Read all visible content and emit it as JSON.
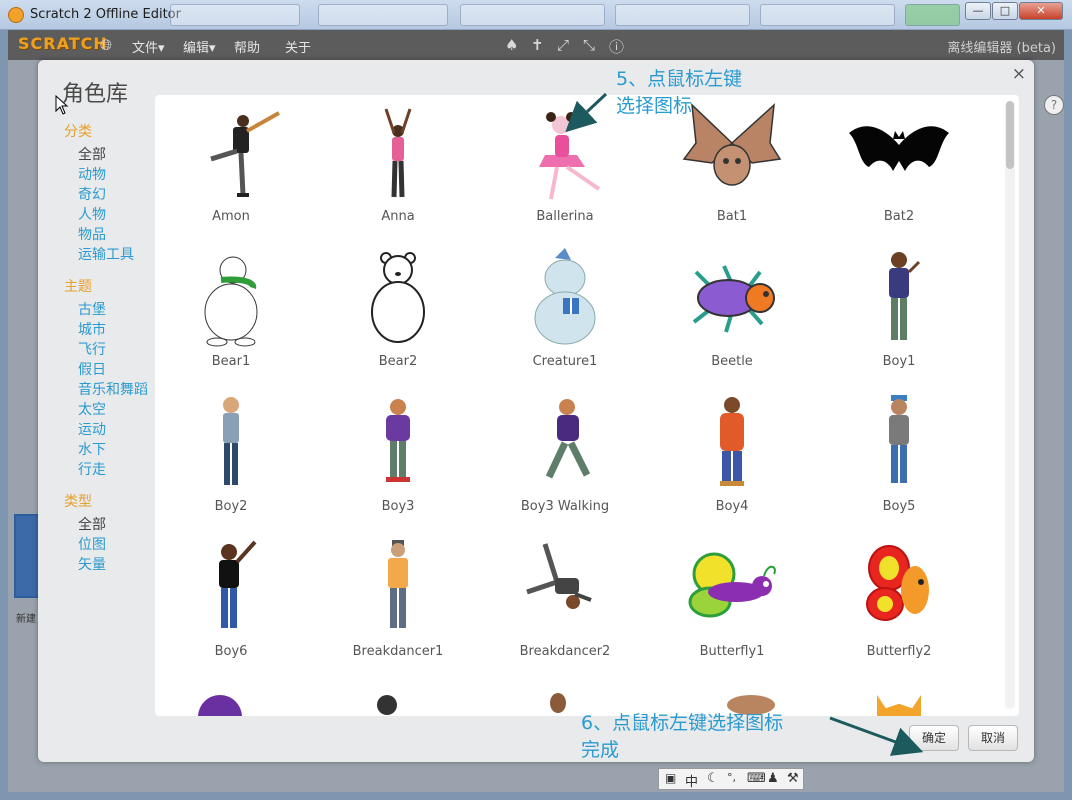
{
  "window": {
    "title": "Scratch 2 Offline Editor",
    "minimize_label": "0",
    "maximize_label": "1",
    "close_label": "r"
  },
  "menubar": {
    "logo": "SCRATCH",
    "items": [
      "文件▾",
      "编辑▾",
      "帮助",
      "关于"
    ],
    "mode_label": "离线编辑器 (beta)"
  },
  "editor": {
    "new_sprite_label": "新建"
  },
  "dialog": {
    "title": "角色库",
    "close": "×",
    "categories_header": "分类",
    "categories": [
      "全部",
      "动物",
      "奇幻",
      "人物",
      "物品",
      "运输工具"
    ],
    "themes_header": "主题",
    "themes": [
      "古堡",
      "城市",
      "飞行",
      "假日",
      "音乐和舞蹈",
      "太空",
      "运动",
      "水下",
      "行走"
    ],
    "types_header": "类型",
    "types": [
      "全部",
      "位图",
      "矢量"
    ],
    "ok_label": "确定",
    "cancel_label": "取消"
  },
  "sprites": [
    {
      "name": "Amon"
    },
    {
      "name": "Anna"
    },
    {
      "name": "Ballerina"
    },
    {
      "name": "Bat1"
    },
    {
      "name": "Bat2"
    },
    {
      "name": "Bear1"
    },
    {
      "name": "Bear2"
    },
    {
      "name": "Creature1"
    },
    {
      "name": "Beetle"
    },
    {
      "name": "Boy1"
    },
    {
      "name": "Boy2"
    },
    {
      "name": "Boy3"
    },
    {
      "name": "Boy3 Walking"
    },
    {
      "name": "Boy4"
    },
    {
      "name": "Boy5"
    },
    {
      "name": "Boy6"
    },
    {
      "name": "Breakdancer1"
    },
    {
      "name": "Breakdancer2"
    },
    {
      "name": "Butterfly1"
    },
    {
      "name": "Butterfly2"
    }
  ],
  "annotations": {
    "step5_line1": "5、点鼠标左键",
    "step5_line2": "选择图标",
    "step6_line1": "6、点鼠标左键选择图标",
    "step6_line2": "完成"
  },
  "ime": {
    "mode": "中"
  },
  "colors": {
    "accent_blue": "#2a9bd1",
    "header_orange": "#e6a02c",
    "dialog_bg": "#e9eaeb",
    "arrow": "#1d5a5e"
  }
}
